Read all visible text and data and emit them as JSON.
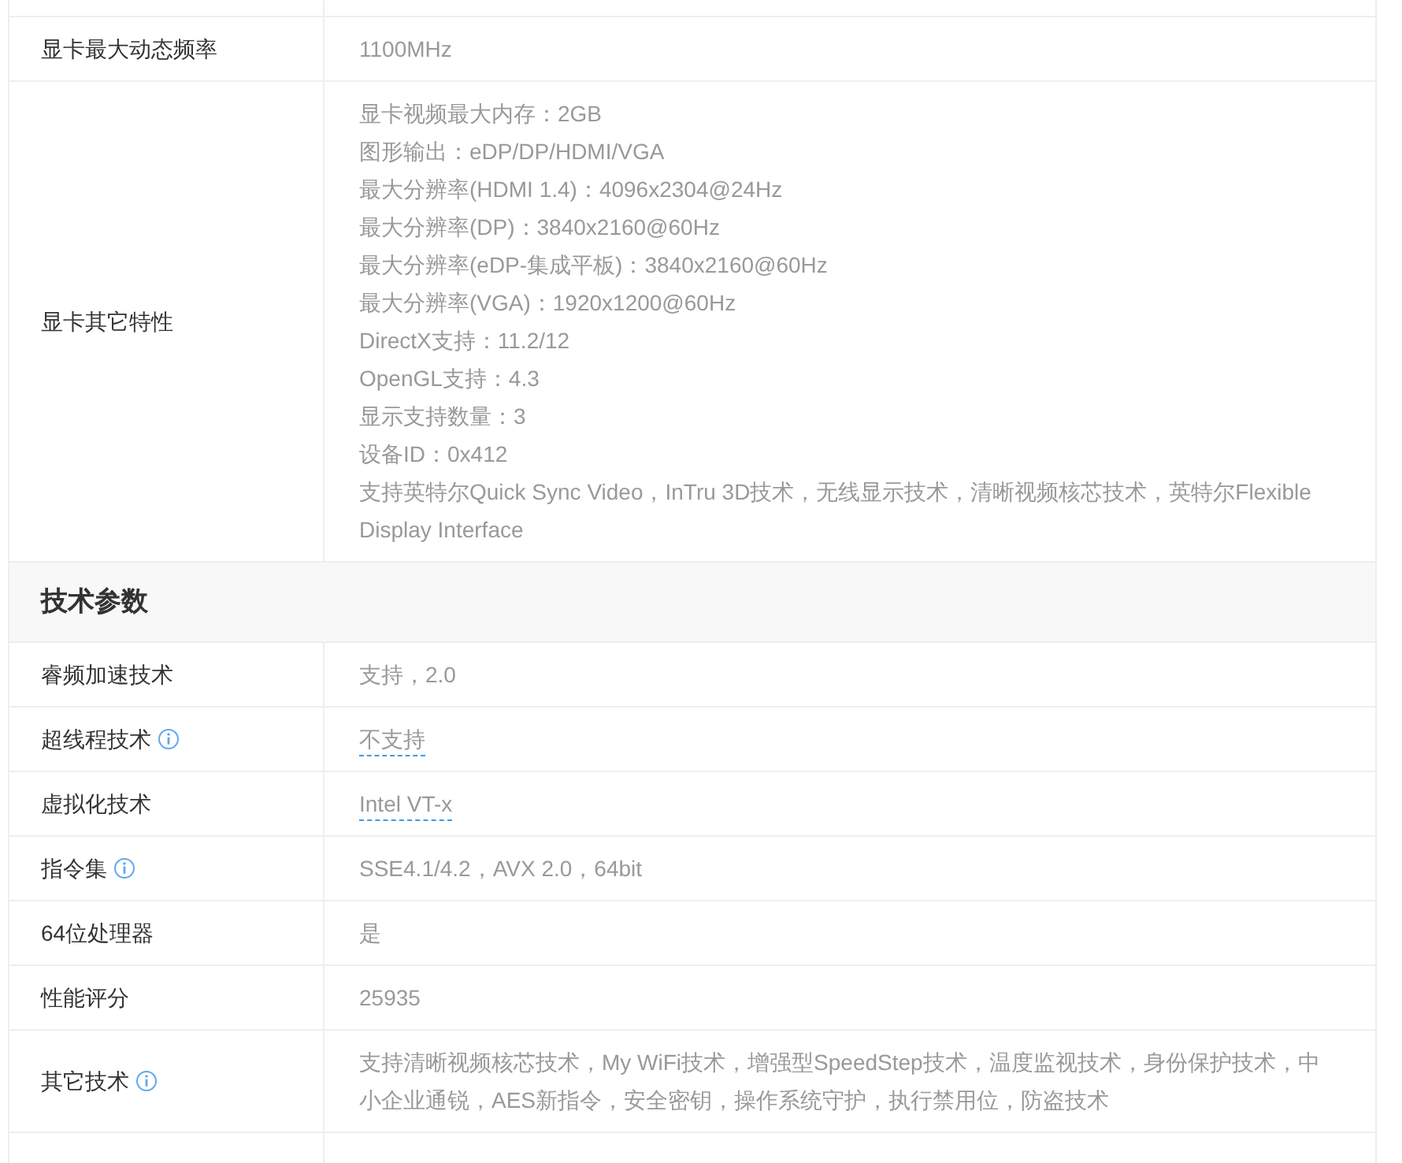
{
  "graphics_rows": [
    {
      "label": "显卡最大动态频率",
      "info": false,
      "dashed": false,
      "lines": [
        "1100MHz"
      ]
    },
    {
      "label": "显卡其它特性",
      "info": false,
      "dashed": false,
      "lines": [
        "显卡视频最大内存：2GB",
        "图形输出：eDP/DP/HDMI/VGA",
        "最大分辨率(HDMI 1.4)：4096x2304@24Hz",
        "最大分辨率(DP)：3840x2160@60Hz",
        "最大分辨率(eDP-集成平板)：3840x2160@60Hz",
        "最大分辨率(VGA)：1920x1200@60Hz",
        "DirectX支持：11.2/12",
        "OpenGL支持：4.3",
        "显示支持数量：3",
        "设备ID：0x412",
        "支持英特尔Quick Sync Video，InTru 3D技术，无线显示技术，清晰视频核芯技术，英特尔Flexible Display Interface"
      ]
    }
  ],
  "tech_section": {
    "title": "技术参数",
    "rows": [
      {
        "label": "睿频加速技术",
        "info": false,
        "dashed": false,
        "lines": [
          "支持，2.0"
        ]
      },
      {
        "label": "超线程技术",
        "info": true,
        "dashed": true,
        "lines": [
          "不支持"
        ]
      },
      {
        "label": "虚拟化技术",
        "info": false,
        "dashed": true,
        "lines": [
          "Intel VT-x"
        ]
      },
      {
        "label": "指令集",
        "info": true,
        "dashed": false,
        "lines": [
          "SSE4.1/4.2，AVX 2.0，64bit"
        ]
      },
      {
        "label": "64位处理器",
        "info": false,
        "dashed": false,
        "lines": [
          "是"
        ]
      },
      {
        "label": "性能评分",
        "info": false,
        "dashed": false,
        "lines": [
          "25935"
        ]
      },
      {
        "label": "其它技术",
        "info": true,
        "dashed": false,
        "lines": [
          "支持清晰视频核芯技术，My WiFi技术，增强型SpeedStep技术，温度监视技术，身份保护技术，中小企业通锐，AES新指令，安全密钥，操作系统守护，执行禁用位，防盗技术"
        ]
      }
    ]
  }
}
